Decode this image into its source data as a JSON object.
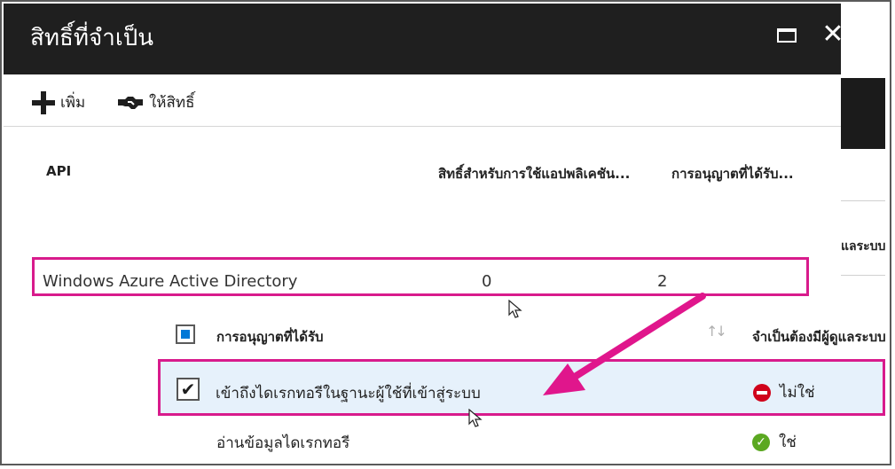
{
  "blade": {
    "title": "สิทธิ์ที่จำเป็น",
    "maximize_icon": "maximize-icon",
    "close_icon": "close-icon"
  },
  "toolbar": {
    "add_label": "เพิ่ม",
    "grant_label": "ให้สิทธิ์"
  },
  "table": {
    "headers": {
      "api": "API",
      "app_permissions": "สิทธิ์สำหรับการใช้แอปพลิเคชัน...",
      "delegated_permissions": "การอนุญาตที่ได้รับ..."
    },
    "rows": [
      {
        "api": "Windows Azure Active Directory",
        "app_permissions": "0",
        "delegated_permissions": "2"
      }
    ]
  },
  "permissions_panel": {
    "header_label": "การอนุญาตที่ได้รับ",
    "admin_header": "จำเป็นต้องมีผู้ดูแลระบบ",
    "items": [
      {
        "name": "เข้าถึงไดเรกทอรีในฐานะผู้ใช้ที่เข้าสู่ระบบ",
        "checked": true,
        "admin_required": "ไม่ใช่",
        "status_icon": "no-entry-icon"
      },
      {
        "name": "อ่านข้อมูลไดเรกทอรี",
        "checked": false,
        "admin_required": "ใช่",
        "status_icon": "check-circle-icon"
      }
    ]
  },
  "background_blade": {
    "label": "แลระบบ"
  },
  "colors": {
    "highlight": "#d81b8c",
    "header_bg": "#1f1f1f",
    "selected_row": "#e6f1fb",
    "accent": "#0078d7"
  }
}
